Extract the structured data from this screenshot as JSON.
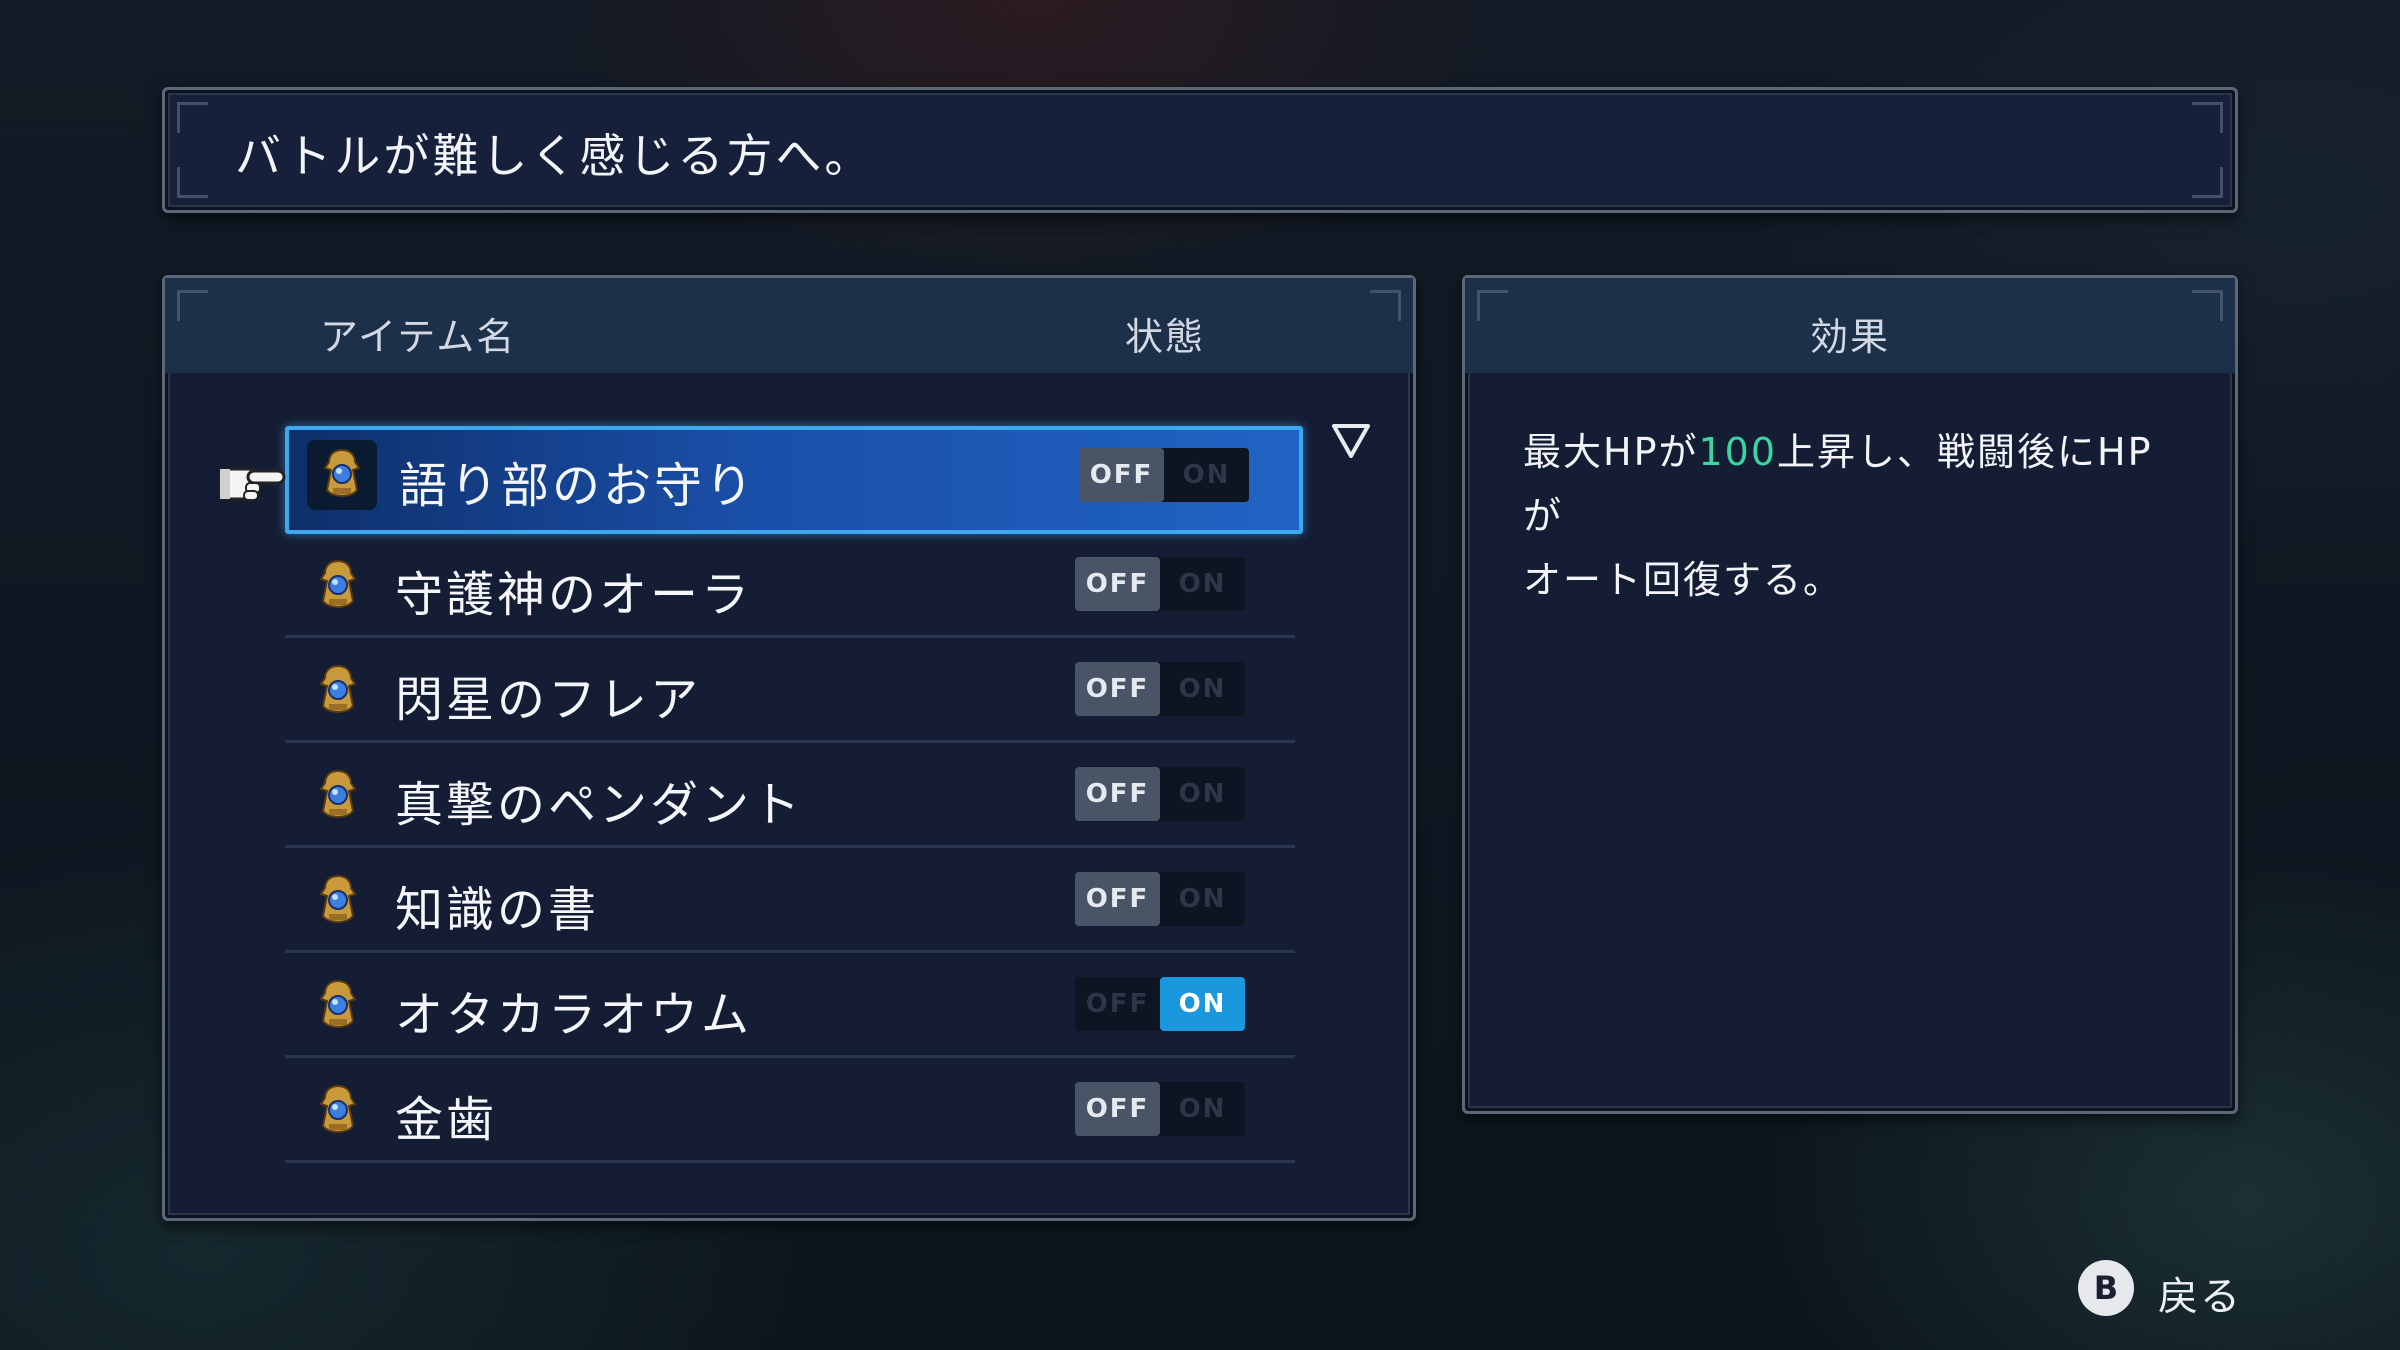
{
  "description": "バトルが難しく感じる方へ。",
  "list": {
    "header_name": "アイテム名",
    "header_state": "状態",
    "items": [
      {
        "label": "語り部のお守り",
        "off": "OFF",
        "on": "ON",
        "state": "off",
        "selected": true
      },
      {
        "label": "守護神のオーラ",
        "off": "OFF",
        "on": "ON",
        "state": "off",
        "selected": false
      },
      {
        "label": "閃星のフレア",
        "off": "OFF",
        "on": "ON",
        "state": "off",
        "selected": false
      },
      {
        "label": "真撃のペンダント",
        "off": "OFF",
        "on": "ON",
        "state": "off",
        "selected": false
      },
      {
        "label": "知識の書",
        "off": "OFF",
        "on": "ON",
        "state": "off",
        "selected": false
      },
      {
        "label": "オタカラオウム",
        "off": "OFF",
        "on": "ON",
        "state": "on",
        "selected": false
      },
      {
        "label": "金歯",
        "off": "OFF",
        "on": "ON",
        "state": "off",
        "selected": false
      }
    ]
  },
  "effect": {
    "title": "効果",
    "text_part1": "最大HPが",
    "text_value": "100",
    "text_part2": "上昇し、戦闘後にHPが",
    "text_line2": "オート回復する。"
  },
  "footer": {
    "button": "B",
    "label": "戻る"
  },
  "colors": {
    "accent": "#3da7ef",
    "on_active": "#1b98dd",
    "highlight": "#3ad6a0"
  },
  "icons": {
    "item": "amulet-icon",
    "cursor": "pointing-hand-icon",
    "scroll": "triangle-down-icon"
  }
}
